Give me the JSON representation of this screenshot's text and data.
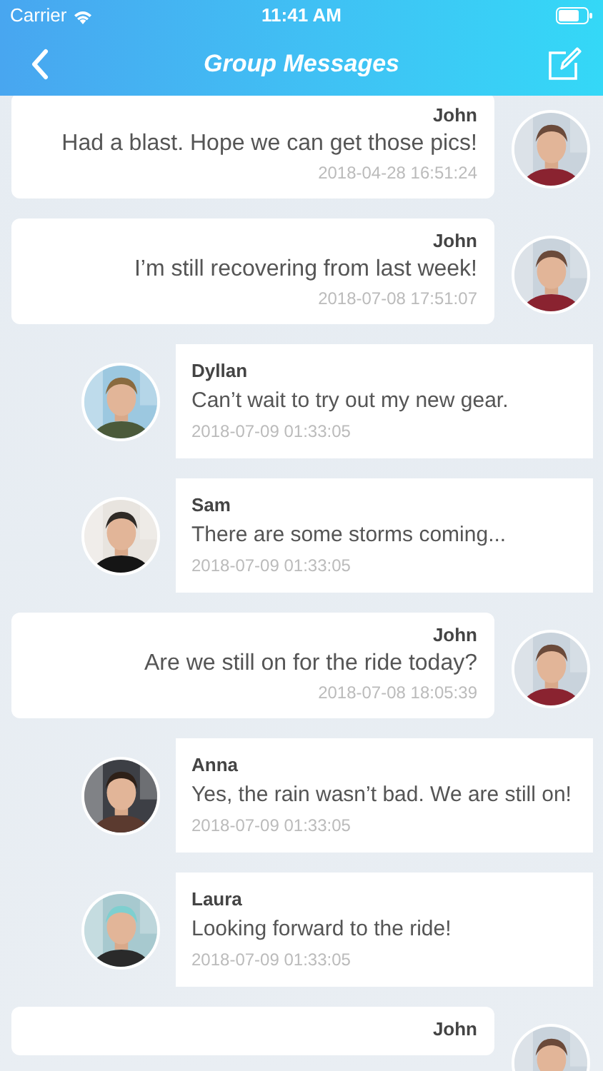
{
  "status_bar": {
    "carrier": "Carrier",
    "time": "11:41 AM"
  },
  "nav": {
    "title": "Group Messages"
  },
  "messages": [
    {
      "kind": "outgoing",
      "name": "John",
      "text": "Had a blast. Hope we can get those pics!",
      "time": "2018-04-28 16:51:24"
    },
    {
      "kind": "outgoing",
      "name": "John",
      "text": "I’m still recovering from last week!",
      "time": "2018-07-08 17:51:07"
    },
    {
      "kind": "incoming",
      "name": "Dyllan",
      "text": "Can’t wait to try out my new gear.",
      "time": "2018-07-09 01:33:05"
    },
    {
      "kind": "incoming",
      "name": "Sam",
      "text": "There are some storms coming...",
      "time": "2018-07-09 01:33:05"
    },
    {
      "kind": "outgoing",
      "name": "John",
      "text": "Are we still on for the ride today?",
      "time": "2018-07-08 18:05:39"
    },
    {
      "kind": "incoming",
      "name": "Anna",
      "text": "Yes, the rain wasn’t bad. We are still on!",
      "time": "2018-07-09 01:33:05"
    },
    {
      "kind": "incoming",
      "name": "Laura",
      "text": "Looking forward to the ride!",
      "time": "2018-07-09 01:33:05"
    },
    {
      "kind": "outgoing",
      "name": "John"
    }
  ]
}
